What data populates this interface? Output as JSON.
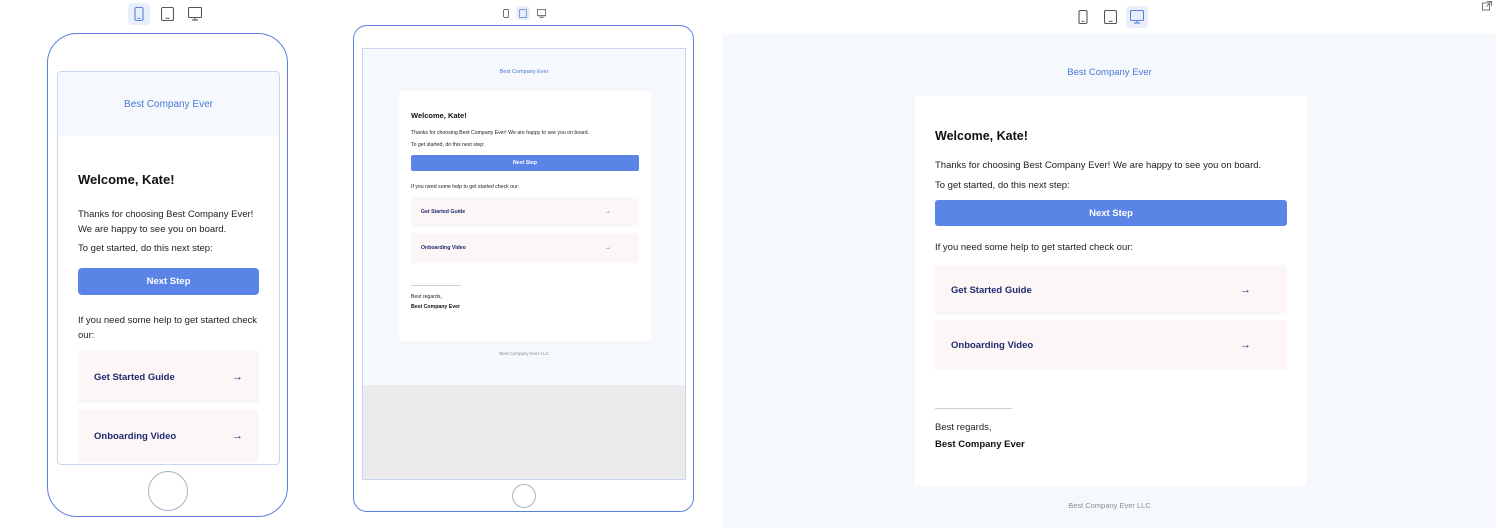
{
  "email": {
    "company_header": "Best Company Ever",
    "greeting": "Welcome, Kate!",
    "intro": "Thanks for choosing Best Company Ever! We are happy to see you on board.",
    "next_step_prompt": "To get started, do this next step:",
    "cta_label": "Next Step",
    "help_prompt": "If you need some help to get started check our:",
    "links": [
      {
        "label": "Get Started Guide",
        "arrow": "→"
      },
      {
        "label": "Onboarding Video",
        "arrow": "→"
      }
    ],
    "regards": "Best regards,",
    "signature": "Best Company Ever",
    "footer": "Best Company Ever LLC"
  },
  "device_toggle": {
    "options": [
      "mobile-icon",
      "tablet-icon",
      "desktop-icon"
    ]
  },
  "colors": {
    "accent": "#5a84e5",
    "device_border": "#5b7fdc",
    "header_text": "#4a78d6",
    "link_bg": "#fdf6f6",
    "link_text": "#1f2a6e",
    "panel_bg": "#f5f8fc"
  }
}
